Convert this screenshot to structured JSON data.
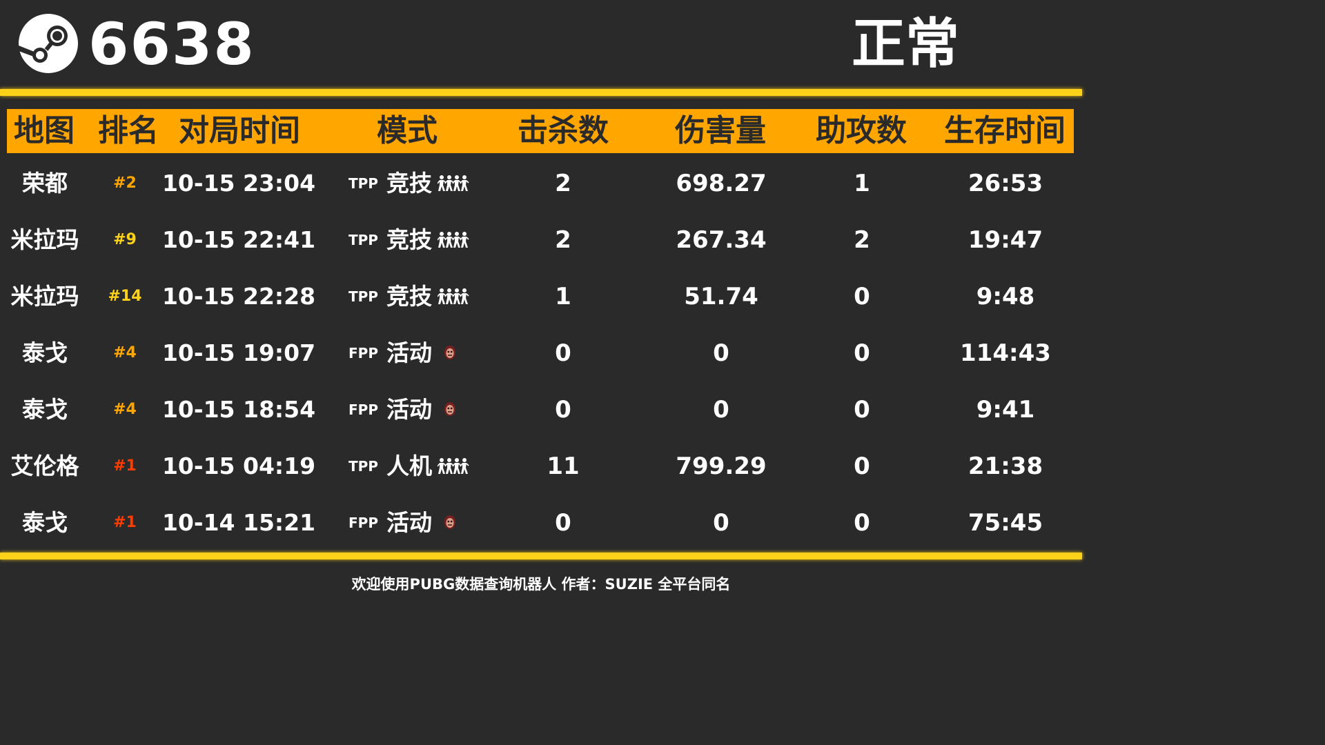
{
  "header": {
    "player_id": "6638",
    "status": "正常"
  },
  "columns": [
    "地图",
    "排名",
    "对局时间",
    "模式",
    "击杀数",
    "伤害量",
    "助攻数",
    "生存时间"
  ],
  "rows": [
    {
      "map": "荣都",
      "rank": "#2",
      "rank_color": "#ffa600",
      "time": "10-15 23:04",
      "perspective": "TPP",
      "mode": "竞技",
      "mode_icon": "squad-icon",
      "kills": "2",
      "damage": "698.27",
      "assists": "1",
      "survival": "26:53"
    },
    {
      "map": "米拉玛",
      "rank": "#9",
      "rank_color": "#ffd21a",
      "time": "10-15 22:41",
      "perspective": "TPP",
      "mode": "竞技",
      "mode_icon": "squad-icon",
      "kills": "2",
      "damage": "267.34",
      "assists": "2",
      "survival": "19:47"
    },
    {
      "map": "米拉玛",
      "rank": "#14",
      "rank_color": "#ffd21a",
      "time": "10-15 22:28",
      "perspective": "TPP",
      "mode": "竞技",
      "mode_icon": "squad-icon",
      "kills": "1",
      "damage": "51.74",
      "assists": "0",
      "survival": "9:48"
    },
    {
      "map": "泰戈",
      "rank": "#4",
      "rank_color": "#ffa600",
      "time": "10-15 19:07",
      "perspective": "FPP",
      "mode": "活动",
      "mode_icon": "zombie-icon",
      "kills": "0",
      "damage": "0",
      "assists": "0",
      "survival": "114:43"
    },
    {
      "map": "泰戈",
      "rank": "#4",
      "rank_color": "#ffa600",
      "time": "10-15 18:54",
      "perspective": "FPP",
      "mode": "活动",
      "mode_icon": "zombie-icon",
      "kills": "0",
      "damage": "0",
      "assists": "0",
      "survival": "9:41"
    },
    {
      "map": "艾伦格",
      "rank": "#1",
      "rank_color": "#ff3b00",
      "time": "10-15 04:19",
      "perspective": "TPP",
      "mode": "人机",
      "mode_icon": "squad-icon",
      "kills": "11",
      "damage": "799.29",
      "assists": "0",
      "survival": "21:38"
    },
    {
      "map": "泰戈",
      "rank": "#1",
      "rank_color": "#ff3b00",
      "time": "10-14 15:21",
      "perspective": "FPP",
      "mode": "活动",
      "mode_icon": "zombie-icon",
      "kills": "0",
      "damage": "0",
      "assists": "0",
      "survival": "75:45"
    }
  ],
  "footer": {
    "text": "欢迎使用PUBG数据查询机器人 作者：SUZIE 全平台同名"
  },
  "colors": {
    "background": "#2a2a2a",
    "accent_bar": "#ffd21a",
    "header_fill": "#ffa600",
    "text": "#ffffff"
  }
}
